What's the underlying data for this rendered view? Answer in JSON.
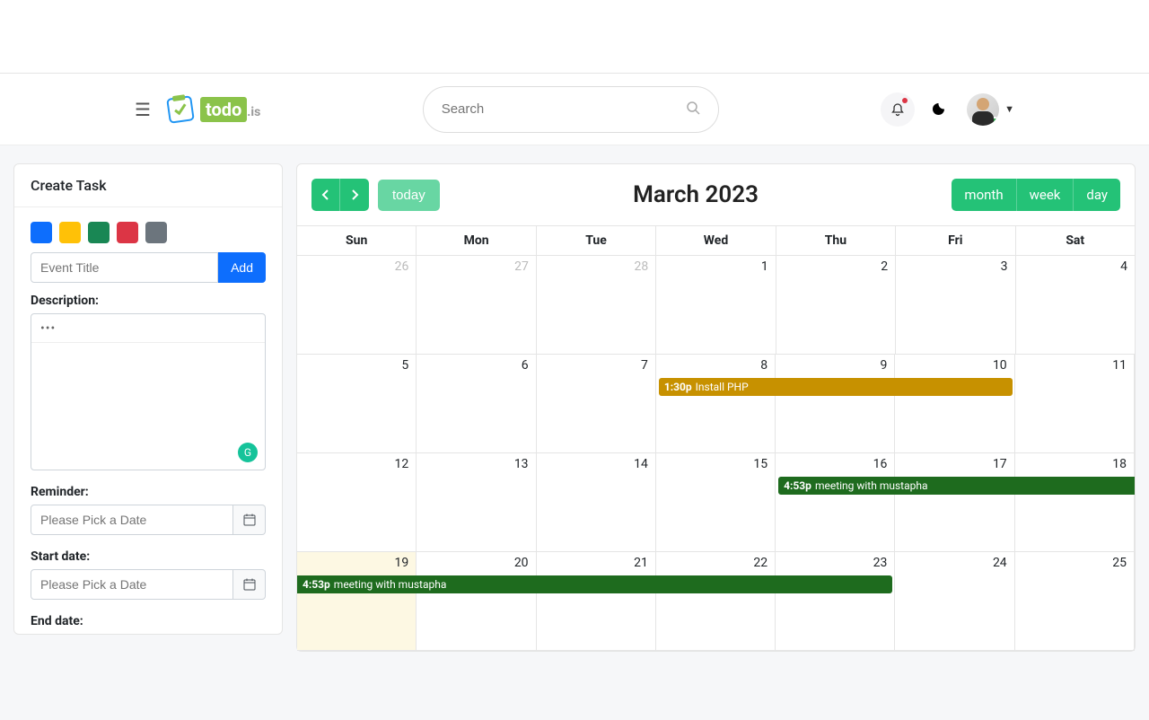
{
  "header": {
    "search_placeholder": "Search",
    "logo_todo": "todo",
    "logo_is": ".is"
  },
  "sidebar": {
    "title": "Create Task",
    "colors": [
      "#0d6efd",
      "#ffc107",
      "#198754",
      "#dc3545",
      "#6c757d"
    ],
    "event_title_placeholder": "Event Title",
    "add_label": "Add",
    "description_label": "Description:",
    "reminder_label": "Reminder:",
    "start_date_label": "Start date:",
    "end_date_label": "End date:",
    "date_placeholder": "Please Pick a Date"
  },
  "calendar": {
    "today_label": "today",
    "title": "March 2023",
    "views": {
      "month": "month",
      "week": "week",
      "day": "day"
    },
    "day_headers": [
      "Sun",
      "Mon",
      "Tue",
      "Wed",
      "Thu",
      "Fri",
      "Sat"
    ],
    "weeks": [
      [
        {
          "n": "26",
          "other": true
        },
        {
          "n": "27",
          "other": true
        },
        {
          "n": "28",
          "other": true
        },
        {
          "n": "1"
        },
        {
          "n": "2"
        },
        {
          "n": "3"
        },
        {
          "n": "4"
        }
      ],
      [
        {
          "n": "5"
        },
        {
          "n": "6"
        },
        {
          "n": "7"
        },
        {
          "n": "8"
        },
        {
          "n": "9"
        },
        {
          "n": "10"
        },
        {
          "n": "11"
        }
      ],
      [
        {
          "n": "12"
        },
        {
          "n": "13"
        },
        {
          "n": "14"
        },
        {
          "n": "15"
        },
        {
          "n": "16"
        },
        {
          "n": "17"
        },
        {
          "n": "18"
        }
      ],
      [
        {
          "n": "19",
          "today": true
        },
        {
          "n": "20"
        },
        {
          "n": "21"
        },
        {
          "n": "22"
        },
        {
          "n": "23"
        },
        {
          "n": "24"
        },
        {
          "n": "25"
        }
      ]
    ],
    "events": [
      {
        "row": 1,
        "start": 3,
        "end": 5,
        "time": "1:30p",
        "title": "Install PHP",
        "color": "#c79100"
      },
      {
        "row": 2,
        "start": 4,
        "end": 6,
        "time": "4:53p",
        "title": "meeting with mustapha",
        "color": "#1e6b1e",
        "extend_right": true
      },
      {
        "row": 3,
        "start": 0,
        "end": 4,
        "time": "4:53p",
        "title": "meeting with mustapha",
        "color": "#1e6b1e",
        "extend_left": true
      }
    ]
  }
}
